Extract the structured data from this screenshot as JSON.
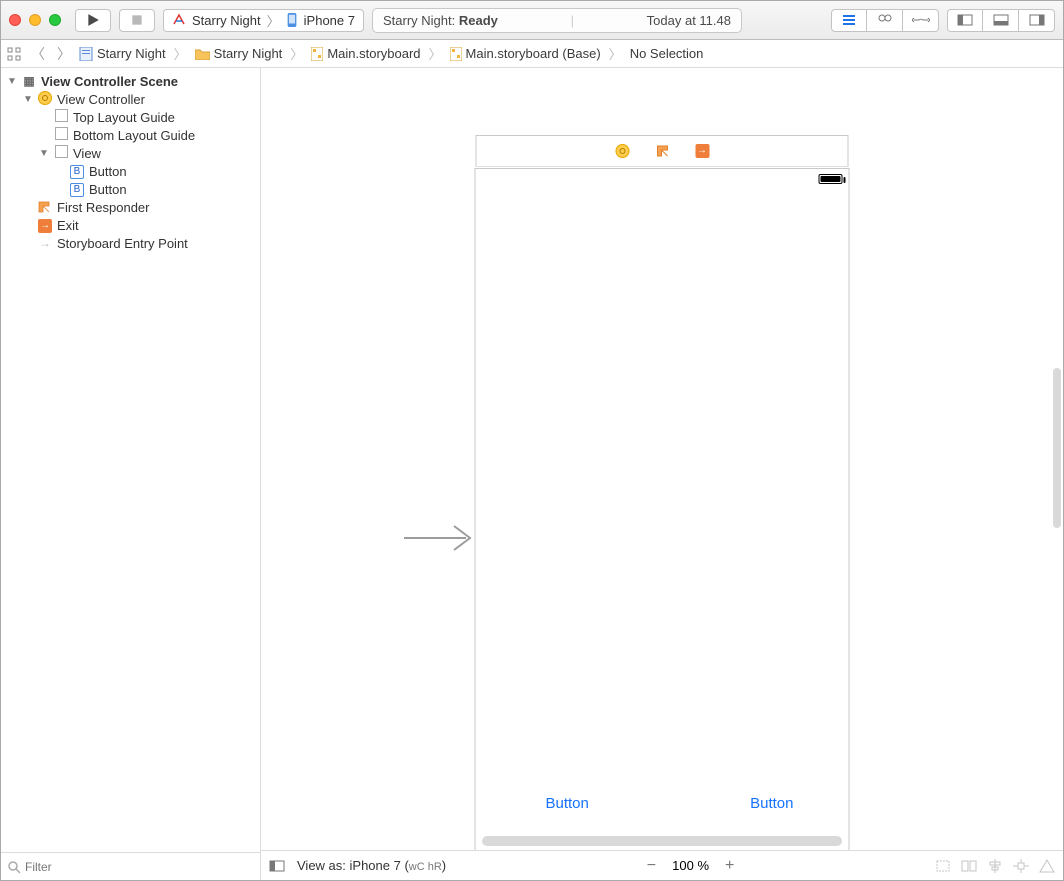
{
  "toolbar": {
    "scheme": {
      "target": "Starry Night",
      "device": "iPhone 7"
    },
    "status": {
      "project": "Starry Night:",
      "state": "Ready",
      "time": "Today at 11.48"
    }
  },
  "jumpbar": {
    "project": "Starry Night",
    "folder": "Starry Night",
    "file": "Main.storyboard",
    "sub": "Main.storyboard (Base)",
    "selection": "No Selection"
  },
  "outline": {
    "scene": "View Controller Scene",
    "vc": "View Controller",
    "top_guide": "Top Layout Guide",
    "bottom_guide": "Bottom Layout Guide",
    "view": "View",
    "button1": "Button",
    "button2": "Button",
    "first_responder": "First Responder",
    "exit": "Exit",
    "entry_point": "Storyboard Entry Point"
  },
  "filter": {
    "placeholder": "Filter"
  },
  "canvas": {
    "ui_button1": "Button",
    "ui_button2": "Button"
  },
  "bottombar": {
    "view_as": "View as: iPhone 7 (",
    "wc": "wC",
    "hr": " hR",
    "close": ")",
    "zoom": "100 %"
  }
}
